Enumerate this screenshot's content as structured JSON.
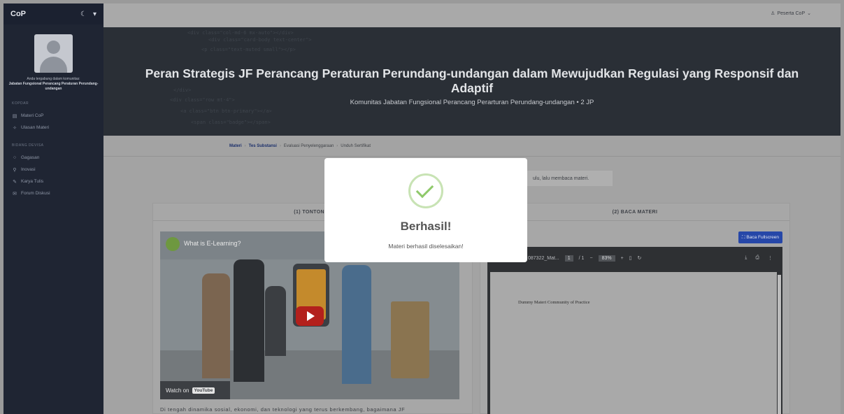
{
  "sidebar": {
    "brand": "CoP",
    "description_prefix": "Anda tergabung dalam komunitas:",
    "community": "Jabatan Fungsional Perancang Peraturan Perundang-undangan",
    "section1": "KOPDAR",
    "menu1": [
      {
        "label": "Materi CoP",
        "icon": "book-icon"
      },
      {
        "label": "Ulasan Materi",
        "icon": "rating-icon"
      }
    ],
    "section2": "BIDANG DEVISA",
    "menu2": [
      {
        "label": "Gagasan",
        "icon": "idea-icon"
      },
      {
        "label": "Inovasi",
        "icon": "pin-icon"
      },
      {
        "label": "Karya Tulis",
        "icon": "pen-icon"
      },
      {
        "label": "Forum Diskusi",
        "icon": "chat-icon"
      }
    ]
  },
  "topbar": {
    "user": "Peserta CoP"
  },
  "hero": {
    "title": "Peran Strategis JF Perancang Peraturan Perundang-undangan dalam Mewujudkan Regulasi yang Responsif dan Adaptif",
    "subtitle": "Komunitas Jabatan Fungsional Perancang Perarturan Perundang-undangan • 2 JP"
  },
  "breadcrumb": {
    "items": [
      "Materi",
      "Tes Substansi",
      "Evaluasi Penyelenggaraan",
      "Unduh Sertifikat"
    ]
  },
  "info_note": "ulu, lalu membaca materi.",
  "left_panel": {
    "header": "(1) TONTON VI",
    "video_title": "What is E-Learning?",
    "watch_on": "Watch on",
    "youtube": "YouTube",
    "text": "Di tengah dinamika sosial, ekonomi, dan teknologi yang terus berkembang, bagaimana JF"
  },
  "right_panel": {
    "header": "(2) BACA MATERI",
    "fullscreen_button": "Baca Fullscreen",
    "pdf_filename": "087322_Mat...",
    "pdf_page": "1",
    "pdf_pages_total": "/ 1",
    "pdf_zoom": "83%",
    "pdf_text": "Dummy Materi Community of Practice"
  },
  "modal": {
    "title": "Berhasil!",
    "message": "Materi berhasil diselesaikan!"
  },
  "colors": {
    "accent": "#2647a8",
    "success": "#8fc96a",
    "sidebar": "#1f2533",
    "hero": "#2a2f36"
  }
}
